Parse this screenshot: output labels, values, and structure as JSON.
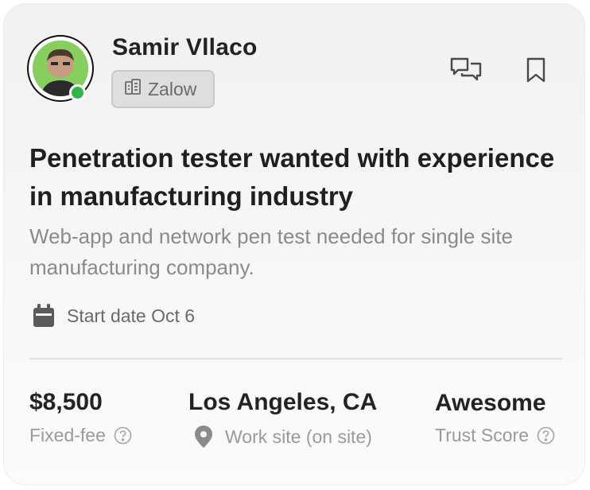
{
  "poster": {
    "name": "Samir Vllaco",
    "company": "Zalow",
    "online": true
  },
  "actions": {
    "chat_icon": "chat-bubbles-icon",
    "bookmark_icon": "bookmark-icon"
  },
  "job": {
    "title": "Penetration tester wanted with experience in manufacturing industry",
    "description": "Web-app and network pen test needed for single site manufacturing company.",
    "start_date_label": "Start date Oct 6"
  },
  "stats": {
    "price": {
      "value": "$8,500",
      "label": "Fixed-fee"
    },
    "location": {
      "value": "Los Angeles, CA",
      "label": "Work site (on site)"
    },
    "trust": {
      "value": "Awesome",
      "label": "Trust Score"
    }
  },
  "colors": {
    "online": "#2fb54a",
    "avatar_bg": "#7cc85a",
    "text_primary": "#222222",
    "text_muted": "#8a8a8a"
  }
}
